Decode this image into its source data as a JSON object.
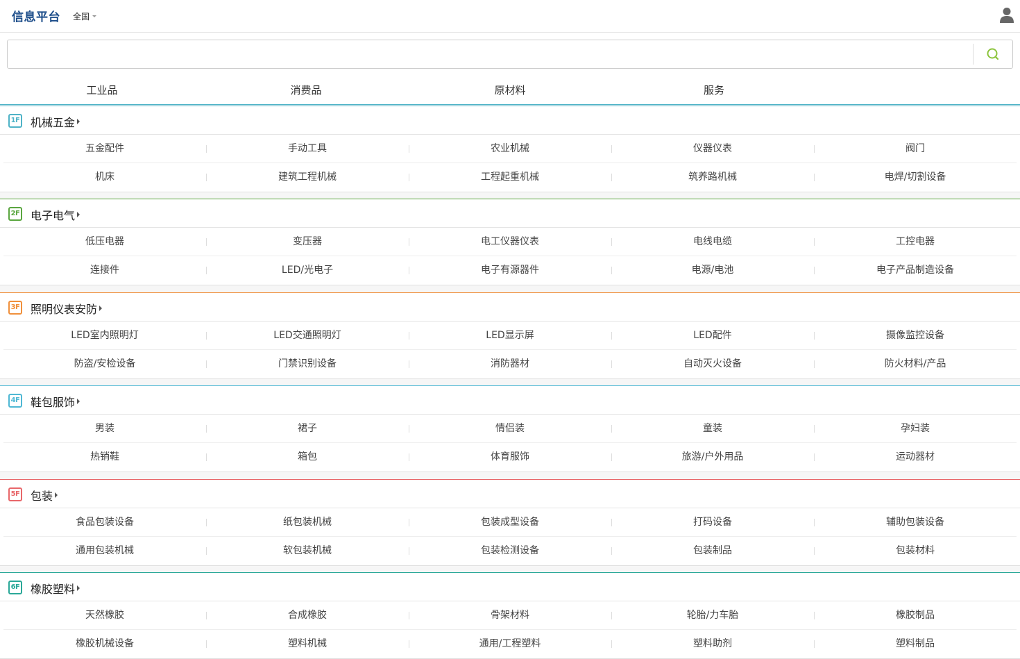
{
  "header": {
    "brand": "信息平台",
    "region": "全国"
  },
  "search": {
    "value": "",
    "placeholder": ""
  },
  "categories": [
    "工业品",
    "消费品",
    "原材料",
    "服务"
  ],
  "floors": [
    {
      "badge": "1F",
      "color": "#4fb3c7",
      "title": "机械五金",
      "rows": [
        [
          "五金配件",
          "手动工具",
          "农业机械",
          "仪器仪表",
          "阀门"
        ],
        [
          "机床",
          "建筑工程机械",
          "工程起重机械",
          "筑养路机械",
          "电焊/切割设备"
        ]
      ]
    },
    {
      "badge": "2F",
      "color": "#5aa640",
      "title": "电子电气",
      "rows": [
        [
          "低压电器",
          "变压器",
          "电工仪器仪表",
          "电线电缆",
          "工控电器"
        ],
        [
          "连接件",
          "LED/光电子",
          "电子有源器件",
          "电源/电池",
          "电子产品制造设备"
        ]
      ]
    },
    {
      "badge": "3F",
      "color": "#f0903c",
      "title": "照明仪表安防",
      "rows": [
        [
          "LED室内照明灯",
          "LED交通照明灯",
          "LED显示屏",
          "LED配件",
          "摄像监控设备"
        ],
        [
          "防盗/安检设备",
          "门禁识别设备",
          "消防器材",
          "自动灭火设备",
          "防火材料/产品"
        ]
      ]
    },
    {
      "badge": "4F",
      "color": "#4fb8d4",
      "title": "鞋包服饰",
      "rows": [
        [
          "男装",
          "裙子",
          "情侣装",
          "童装",
          "孕妇装"
        ],
        [
          "热销鞋",
          "箱包",
          "体育服饰",
          "旅游/户外用品",
          "运动器材"
        ]
      ]
    },
    {
      "badge": "5F",
      "color": "#e8676a",
      "title": "包装",
      "rows": [
        [
          "食品包装设备",
          "纸包装机械",
          "包装成型设备",
          "打码设备",
          "辅助包装设备"
        ],
        [
          "通用包装机械",
          "软包装机械",
          "包装检测设备",
          "包装制品",
          "包装材料"
        ]
      ]
    },
    {
      "badge": "6F",
      "color": "#2aa898",
      "title": "橡胶塑料",
      "rows": [
        [
          "天然橡胶",
          "合成橡胶",
          "骨架材料",
          "轮胎/力车胎",
          "橡胶制品"
        ],
        [
          "橡胶机械设备",
          "塑料机械",
          "通用/工程塑料",
          "塑料助剂",
          "塑料制品"
        ]
      ]
    }
  ]
}
